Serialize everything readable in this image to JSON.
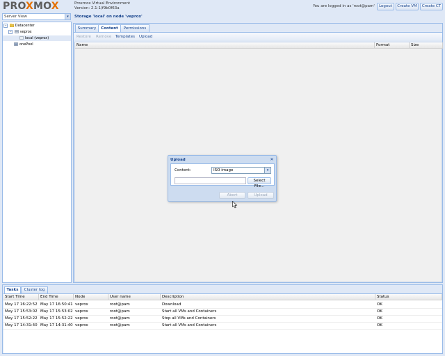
{
  "header": {
    "logo_a": "PRO",
    "logo_x1": "X",
    "logo_b": "MO",
    "logo_x2": "X",
    "product_name": "Proxmox Virtual Environment",
    "version": "Version: 2.1-1/f9b0f63a",
    "logged_in": "You are logged in as 'root@pam'",
    "logout_label": "Logout",
    "create_vm_label": "Create VM",
    "create_ct_label": "Create CT"
  },
  "sidebar": {
    "view_selector": "Server View",
    "tree": [
      {
        "label": "Datacenter",
        "icon": "datacenter-icon",
        "expander": "−"
      },
      {
        "label": "veprox",
        "icon": "server-icon",
        "expander": "−"
      },
      {
        "label": "local (veprox)",
        "icon": "storage-icon"
      },
      {
        "label": "onePool",
        "icon": "pool-icon"
      }
    ]
  },
  "main": {
    "title": "Storage 'local' on node 'veprox'",
    "tabs": [
      "Summary",
      "Content",
      "Permissions"
    ],
    "active_tab": "Content",
    "toolbar": {
      "restore": "Restore",
      "remove": "Remove",
      "templates": "Templates",
      "upload": "Upload"
    },
    "columns": [
      "Name",
      "Format",
      "Size"
    ]
  },
  "dialog": {
    "title": "Upload",
    "content_label": "Content:",
    "content_value": "ISO image",
    "select_file_label": "Select File...",
    "abort_label": "Abort",
    "upload_label": "Upload"
  },
  "bottom": {
    "tabs": [
      "Tasks",
      "Cluster log"
    ],
    "columns": [
      "Start Time",
      "End Time",
      "Node",
      "User name",
      "Description",
      "Status"
    ],
    "rows": [
      {
        "start": "May 17 16:22:52",
        "end": "May 17 16:50:41",
        "node": "veprox",
        "user": "root@pam",
        "desc": "Download",
        "status": "OK"
      },
      {
        "start": "May 17 15:53:02",
        "end": "May 17 15:53:02",
        "node": "veprox",
        "user": "root@pam",
        "desc": "Start all VMs and Containers",
        "status": "OK"
      },
      {
        "start": "May 17 15:52:22",
        "end": "May 17 15:52:22",
        "node": "veprox",
        "user": "root@pam",
        "desc": "Stop all VMs and Containers",
        "status": "OK"
      },
      {
        "start": "May 17 14:31:40",
        "end": "May 17 14:31:40",
        "node": "veprox",
        "user": "root@pam",
        "desc": "Start all VMs and Containers",
        "status": "OK"
      }
    ]
  },
  "colors": {
    "accent": "#e57000",
    "panel_border": "#99bbe8",
    "title_text": "#15428b"
  }
}
